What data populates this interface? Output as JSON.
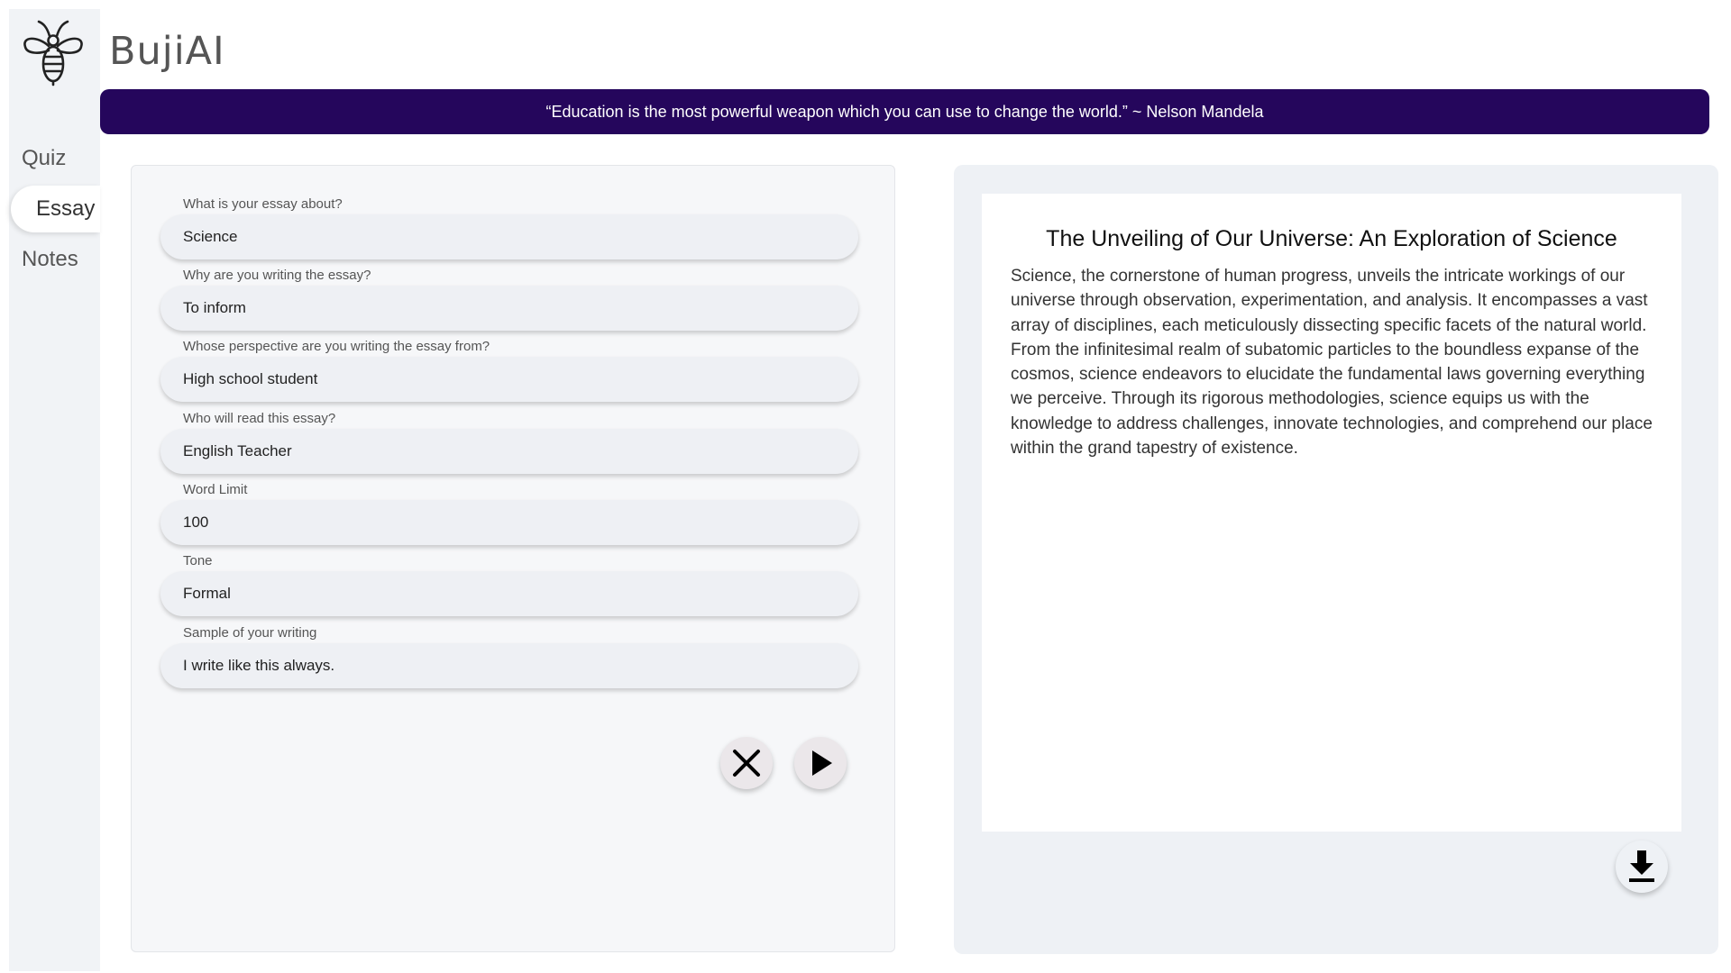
{
  "app": {
    "name": "BujiAI"
  },
  "sidebar": {
    "items": [
      {
        "label": "Quiz",
        "active": false
      },
      {
        "label": "Essay",
        "active": true
      },
      {
        "label": "Notes",
        "active": false
      }
    ]
  },
  "banner": {
    "quote": "“Education is the most powerful weapon which you can use to change the world.” ~ Nelson Mandela"
  },
  "form": {
    "fields": [
      {
        "label": "What is your essay about?",
        "value": "Science"
      },
      {
        "label": "Why are you writing the essay?",
        "value": "To inform"
      },
      {
        "label": "Whose perspective are you writing the essay from?",
        "value": "High school student"
      },
      {
        "label": "Who will read this essay?",
        "value": "English Teacher"
      },
      {
        "label": "Word Limit",
        "value": "100"
      },
      {
        "label": "Tone",
        "value": "Formal"
      },
      {
        "label": "Sample of your writing",
        "value": "I write like this always."
      }
    ],
    "clear_icon": "close-icon",
    "generate_icon": "play-icon"
  },
  "output": {
    "title": "The Unveiling of Our Universe: An Exploration of Science",
    "body": "Science, the cornerstone of human progress, unveils the intricate workings of our universe through observation, experimentation, and analysis. It encompasses a vast array of disciplines, each meticulously dissecting specific facets of the natural world. From the infinitesimal realm of subatomic particles to the boundless expanse of the cosmos, science endeavors to elucidate the fundamental laws governing everything we perceive. Through its rigorous methodologies, science equips us with the knowledge to address challenges, innovate technologies, and comprehend our place within the grand tapestry of existence.",
    "download_icon": "download-icon"
  },
  "colors": {
    "banner_bg": "#25065c",
    "sidebar_bg": "#f1f3f6",
    "panel_bg": "#eef1f5"
  }
}
